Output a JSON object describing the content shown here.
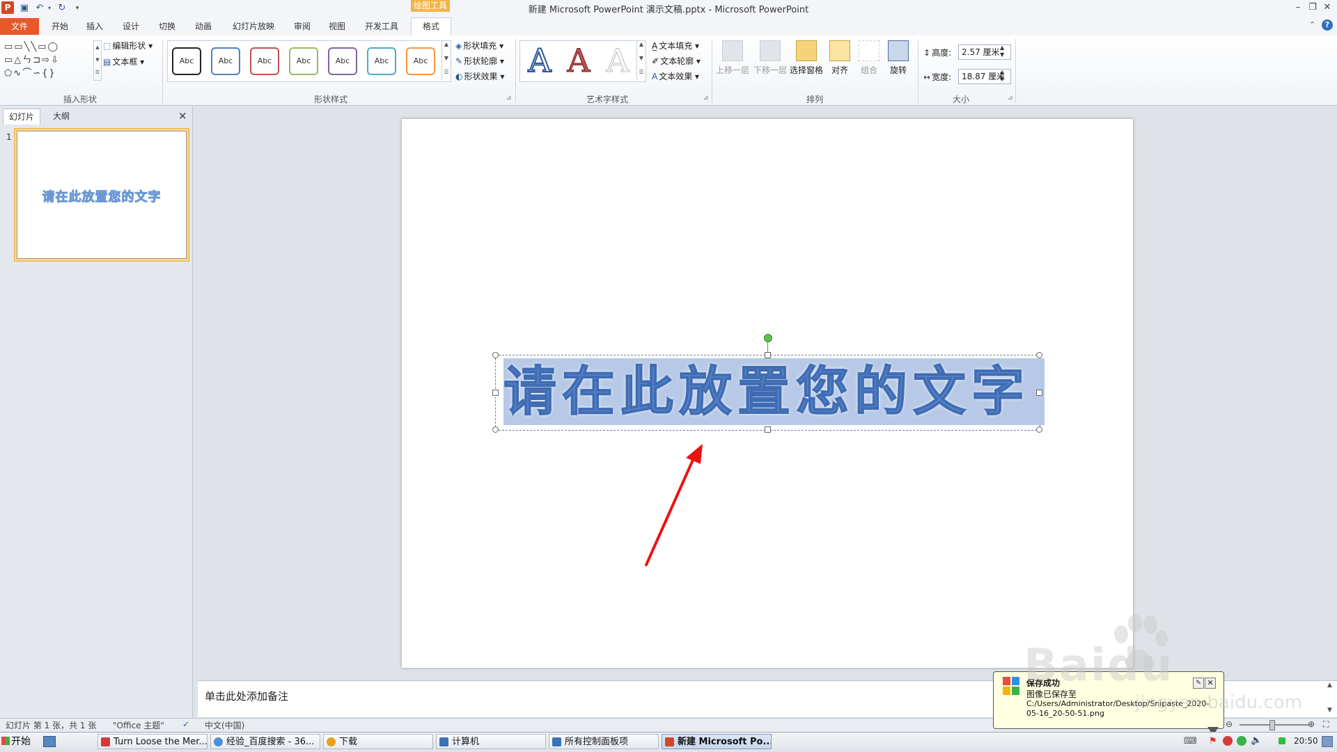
{
  "window": {
    "title": "新建 Microsoft PowerPoint 演示文稿.pptx - Microsoft PowerPoint",
    "context_tab_group": "绘图工具",
    "app_icon": "P"
  },
  "quick_access": [
    "save-icon",
    "undo-icon",
    "redo-icon",
    "customize-icon"
  ],
  "tabs": [
    "文件",
    "开始",
    "插入",
    "设计",
    "切换",
    "动画",
    "幻灯片放映",
    "审阅",
    "视图",
    "开发工具",
    "格式"
  ],
  "active_tab": "格式",
  "ribbon": {
    "insert_shapes": {
      "label": "插入形状",
      "edit_shape": "编辑形状",
      "text_box": "文本框"
    },
    "shape_styles": {
      "label": "形状样式",
      "sample": "Abc",
      "border_colors": [
        "#222222",
        "#4f81bd",
        "#c0504d",
        "#9bbb59",
        "#8064a2",
        "#4bacc6",
        "#f79646"
      ],
      "fill": "形状填充",
      "outline": "形状轮廓",
      "effects": "形状效果"
    },
    "wordart_styles": {
      "label": "艺术字样式",
      "glyph": "A",
      "text_fill": "文本填充",
      "text_outline": "文本轮廓",
      "text_effects": "文本效果"
    },
    "arrange": {
      "label": "排列",
      "bring_forward": "上移一层",
      "send_backward": "下移一层",
      "selection_pane": "选择窗格",
      "align": "对齐",
      "group": "组合",
      "rotate": "旋转"
    },
    "size": {
      "label": "大小",
      "height_label": "高度:",
      "height_value": "2.57 厘米",
      "width_label": "宽度:",
      "width_value": "18.87 厘米"
    }
  },
  "left_panel": {
    "tabs": [
      "幻灯片",
      "大纲"
    ],
    "slide_number": "1",
    "thumbnail_text": "请在此放置您的文字"
  },
  "slide": {
    "placeholder_text": "请在此放置您的文字"
  },
  "notes": {
    "placeholder": "单击此处添加备注"
  },
  "status": {
    "slide_info": "幻灯片 第 1 张，共 1 张",
    "theme": "\"Office 主题\"",
    "language": "中文(中国)"
  },
  "notification": {
    "title": "保存成功",
    "line1": "图像已保存至",
    "line2": "C:/Users/Administrator/Desktop/Snipaste_2020-05-16_20-50-51.png"
  },
  "taskbar": {
    "start": "开始",
    "items": [
      {
        "label": "Turn Loose the Mer...",
        "color": "#d33b3b"
      },
      {
        "label": "经验_百度搜索 - 36...",
        "color": "#4a90d9"
      },
      {
        "label": "下载",
        "color": "#e3a21a"
      },
      {
        "label": "计算机",
        "color": "#3a72b8"
      },
      {
        "label": "所有控制面板项",
        "color": "#3a72b8"
      },
      {
        "label": "新建 Microsoft Po...",
        "color": "#d24726"
      }
    ],
    "clock": "20:50"
  },
  "watermark": {
    "text": "Baidu",
    "sub": "jingyan.baidu.com"
  },
  "colors": {
    "file_tab": "#e8582a",
    "context_tab": "#f2b54a",
    "selection_fill": "#b7c9e6",
    "arrow": "#ee1111"
  }
}
